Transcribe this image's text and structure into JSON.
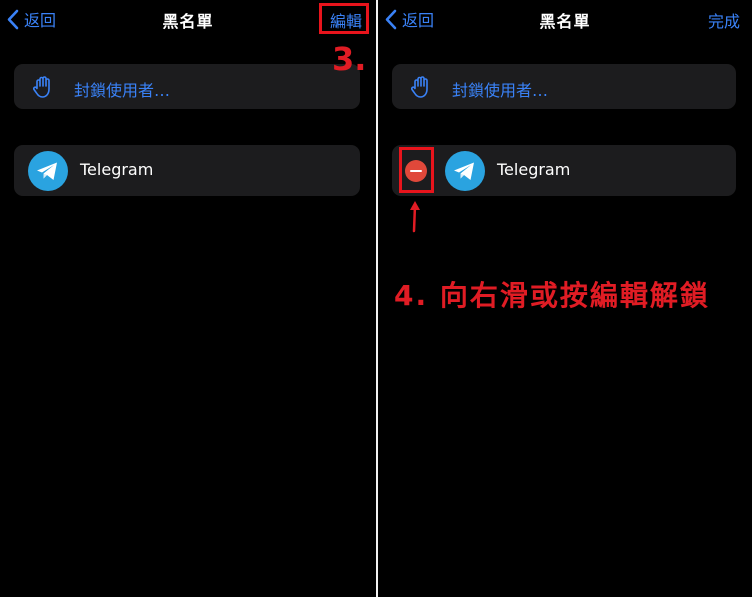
{
  "left": {
    "nav": {
      "back_label": "返回",
      "title": "黑名單",
      "action_label": "編輯"
    },
    "block_row": {
      "label": "封鎖使用者…",
      "icon": "hand-icon"
    },
    "app_row": {
      "label": "Telegram",
      "icon": "telegram-icon"
    }
  },
  "right": {
    "nav": {
      "back_label": "返回",
      "title": "黑名單",
      "action_label": "完成"
    },
    "block_row": {
      "label": "封鎖使用者…",
      "icon": "hand-icon"
    },
    "app_row": {
      "label": "Telegram",
      "icon": "telegram-icon",
      "delete_icon": "minus-circle-icon"
    }
  },
  "annotations": {
    "step3": "3.",
    "step4": "4. 向右滑或按編輯解鎖"
  },
  "colors": {
    "accent": "#3a82f7",
    "card": "#1c1c1e",
    "background": "#000000",
    "delete": "#e0483a",
    "annotation": "#e01c24",
    "telegram": "#2aa3e0"
  }
}
